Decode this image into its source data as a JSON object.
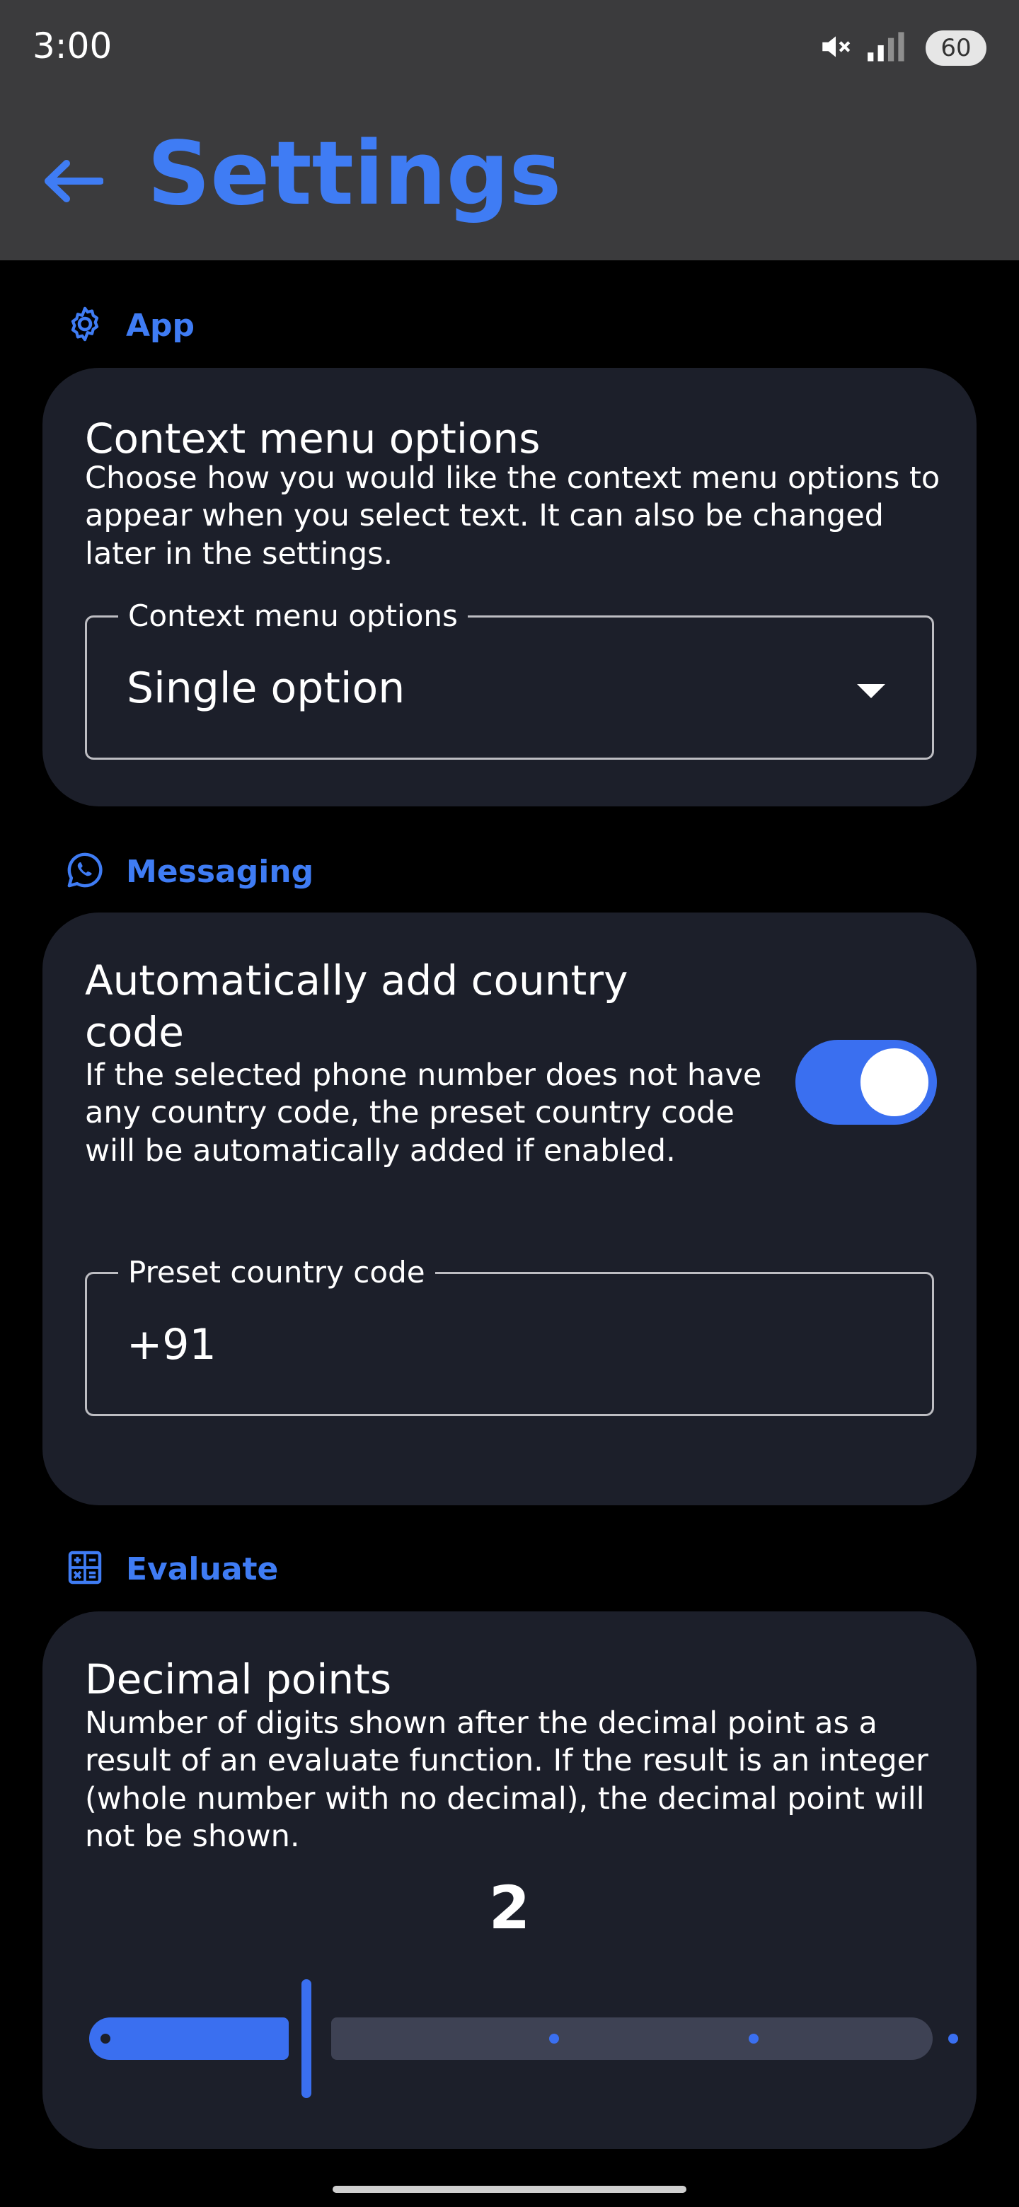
{
  "status_bar": {
    "time": "3:00",
    "icons": [
      "mute-icon",
      "signal-icon"
    ],
    "battery": "60"
  },
  "app_bar": {
    "title": "Settings",
    "back_icon": "arrow-left-icon"
  },
  "colors": {
    "accent": "#3f7cf4",
    "card_bg": "#1c1f2a",
    "bar_bg": "#3b3b3d",
    "page_bg": "#000000"
  },
  "sections": {
    "app": {
      "label": "App",
      "icon": "gear-icon",
      "card": {
        "title": "Context menu options",
        "description": "Choose how you would like the context menu options to appear when you select text. It can also be changed later in the settings.",
        "field_label": "Context menu options",
        "selected_value": "Single option"
      }
    },
    "messaging": {
      "label": "Messaging",
      "icon": "whatsapp-icon",
      "card": {
        "title": "Automatically add country code",
        "description": "If the selected phone number does not have any country code, the preset country code will be automatically added if enabled.",
        "toggle_on": true,
        "field_label": "Preset country code",
        "field_value": "+91"
      }
    },
    "evaluate": {
      "label": "Evaluate",
      "icon": "calculator-icon",
      "card": {
        "title": "Decimal points",
        "description": "Number of digits shown after the decimal point as a result of an evaluate function. If the result is an integer (whole number with no decimal), the decimal point will not be shown.",
        "slider_value": "2",
        "slider_steps": 5
      }
    }
  }
}
